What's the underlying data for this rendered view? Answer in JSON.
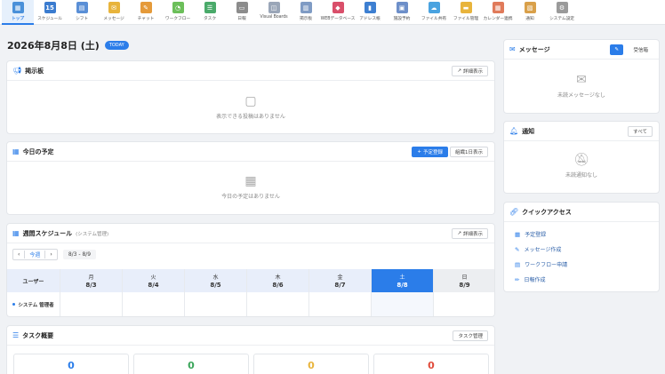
{
  "nav": [
    {
      "label": "トップ",
      "icon": "home-icon",
      "color": "#4a90d9",
      "glyph": "▦",
      "active": true
    },
    {
      "label": "スケジュール",
      "icon": "calendar-15-icon",
      "color": "#3b7ccf",
      "glyph": "15",
      "active": false
    },
    {
      "label": "シフト",
      "icon": "shift-calendar-icon",
      "color": "#5a8fd6",
      "glyph": "▤",
      "active": false
    },
    {
      "label": "メッセージ",
      "icon": "message-icon",
      "color": "#e8b43c",
      "glyph": "✉",
      "active": false
    },
    {
      "label": "チャット",
      "icon": "chat-icon",
      "color": "#e59a3a",
      "glyph": "✎",
      "active": false
    },
    {
      "label": "ワークフロー",
      "icon": "workflow-icon",
      "color": "#6cbf5a",
      "glyph": "◔",
      "active": false
    },
    {
      "label": "タスク",
      "icon": "task-icon",
      "color": "#4aaa6a",
      "glyph": "☰",
      "active": false
    },
    {
      "label": "日報",
      "icon": "daily-report-icon",
      "color": "#8c8c8c",
      "glyph": "▭",
      "active": false
    },
    {
      "label": "Visual Boards",
      "icon": "visual-boards-icon",
      "color": "#9aa6b8",
      "glyph": "◫",
      "active": false
    },
    {
      "label": "掲示板",
      "icon": "bulletin-board-icon",
      "color": "#7f9bc4",
      "glyph": "▥",
      "active": false
    },
    {
      "label": "WEBデータベース",
      "icon": "web-database-icon",
      "color": "#d94f6a",
      "glyph": "◆",
      "active": false
    },
    {
      "label": "アドレス帳",
      "icon": "address-book-icon",
      "color": "#3d7fd1",
      "glyph": "▮",
      "active": false
    },
    {
      "label": "施設予約",
      "icon": "facility-booking-icon",
      "color": "#6d8fc9",
      "glyph": "▣",
      "active": false
    },
    {
      "label": "ファイル共有",
      "icon": "file-share-cloud-icon",
      "color": "#4aa3e0",
      "glyph": "☁",
      "active": false
    },
    {
      "label": "ファイル管理",
      "icon": "file-manager-icon",
      "color": "#e8b43c",
      "glyph": "▬",
      "active": false
    },
    {
      "label": "カレンダー連携",
      "icon": "calendar-sync-icon",
      "color": "#e07a5a",
      "glyph": "▦",
      "active": false
    },
    {
      "label": "通知",
      "icon": "notification-icon",
      "color": "#d9a04a",
      "glyph": "▧",
      "active": false
    },
    {
      "label": "システム設定",
      "icon": "system-settings-gear-icon",
      "color": "#9a9a9a",
      "glyph": "⚙",
      "active": false
    }
  ],
  "date_title": "2026年8月8日 (土)",
  "today_badge": "TODAY",
  "bulletin": {
    "title": "掲示板",
    "detail_btn": "詳細表示",
    "empty": "表示できる投稿はありません"
  },
  "today": {
    "title": "今日の予定",
    "add_btn": "予定登録",
    "week_btn": "組織1日表示",
    "empty": "今日の予定はありません"
  },
  "weekly": {
    "title": "週間スケジュール",
    "sub": "(システム管理)",
    "detail_btn": "詳細表示",
    "prev": "‹",
    "this_week": "今週",
    "next": "›",
    "range": "8/3 - 8/9",
    "user_header": "ユーザー",
    "days": [
      {
        "dow": "月",
        "date": "8/3",
        "today": false,
        "sun": false
      },
      {
        "dow": "火",
        "date": "8/4",
        "today": false,
        "sun": false
      },
      {
        "dow": "水",
        "date": "8/5",
        "today": false,
        "sun": false
      },
      {
        "dow": "木",
        "date": "8/6",
        "today": false,
        "sun": false
      },
      {
        "dow": "金",
        "date": "8/7",
        "today": false,
        "sun": false
      },
      {
        "dow": "土",
        "date": "8/8",
        "today": true,
        "sun": false
      },
      {
        "dow": "日",
        "date": "8/9",
        "today": false,
        "sun": true
      }
    ],
    "user": "システム 管理者"
  },
  "tasks": {
    "title": "タスク概要",
    "manage_btn": "タスク管理",
    "stats": [
      {
        "value": "0",
        "color": "#2b7de9"
      },
      {
        "value": "0",
        "color": "#3aa55a"
      },
      {
        "value": "0",
        "color": "#e8b43c"
      },
      {
        "value": "0",
        "color": "#e04a3a"
      }
    ]
  },
  "message": {
    "title": "メッセージ",
    "compose_btn": "受信箱",
    "empty": "未読メッセージなし"
  },
  "notice": {
    "title": "通知",
    "all_btn": "すべて",
    "empty": "未読通知なし"
  },
  "quick": {
    "title": "クイックアクセス",
    "items": [
      {
        "label": "予定登録",
        "icon": "calendar-icon",
        "glyph": "▦"
      },
      {
        "label": "メッセージ作成",
        "icon": "edit-message-icon",
        "glyph": "✎"
      },
      {
        "label": "ワークフロー申請",
        "icon": "document-icon",
        "glyph": "▤"
      },
      {
        "label": "日報作成",
        "icon": "pencil-icon",
        "glyph": "✏"
      }
    ]
  },
  "colors": {
    "accent": "#2b7de9",
    "background": "#f0f2f5"
  }
}
